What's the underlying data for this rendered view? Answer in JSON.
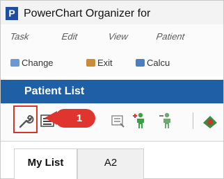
{
  "window": {
    "title": "PowerChart Organizer for",
    "logo_letter": "P"
  },
  "menubar": {
    "items": [
      "Task",
      "Edit",
      "View",
      "Patient"
    ]
  },
  "quickbar": {
    "items": [
      {
        "label": "Change",
        "icon": "people-icon"
      },
      {
        "label": "Exit",
        "icon": "exit-icon"
      },
      {
        "label": "Calcu",
        "icon": "calculator-icon"
      }
    ]
  },
  "patient_list": {
    "header": "Patient List"
  },
  "toolbar": {
    "icons": [
      "wrench-properties-icon",
      "list-icon",
      "list-gray-icon",
      "add-patient-icon",
      "remove-patient-icon",
      "flag-icon"
    ],
    "highlighted_icon": "wrench-properties-icon"
  },
  "callout": {
    "number": "1",
    "color": "#e0352e"
  },
  "tabs": [
    "My List",
    "A2"
  ],
  "colors": {
    "header_blue": "#1f5fa6",
    "highlight_red": "#d9332b"
  }
}
